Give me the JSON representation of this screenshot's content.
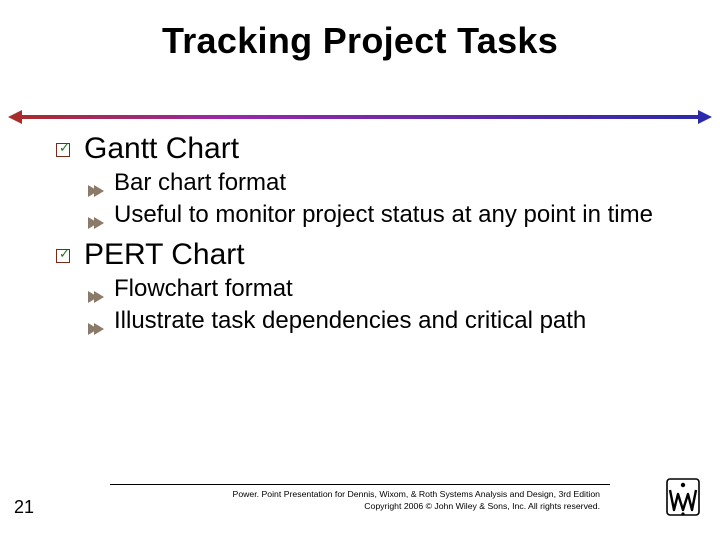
{
  "title": "Tracking Project Tasks",
  "sections": [
    {
      "heading": "Gantt Chart",
      "items": [
        "Bar chart format",
        "Useful to monitor project status at any point in time"
      ]
    },
    {
      "heading": "PERT Chart",
      "items": [
        "Flowchart format",
        "Illustrate task dependencies and critical path"
      ]
    }
  ],
  "footer": {
    "line1": "Power. Point Presentation for Dennis, Wixom, & Roth Systems Analysis and Design, 3rd Edition",
    "line2": "Copyright 2006 © John Wiley & Sons, Inc.  All rights reserved."
  },
  "page_number": "21"
}
